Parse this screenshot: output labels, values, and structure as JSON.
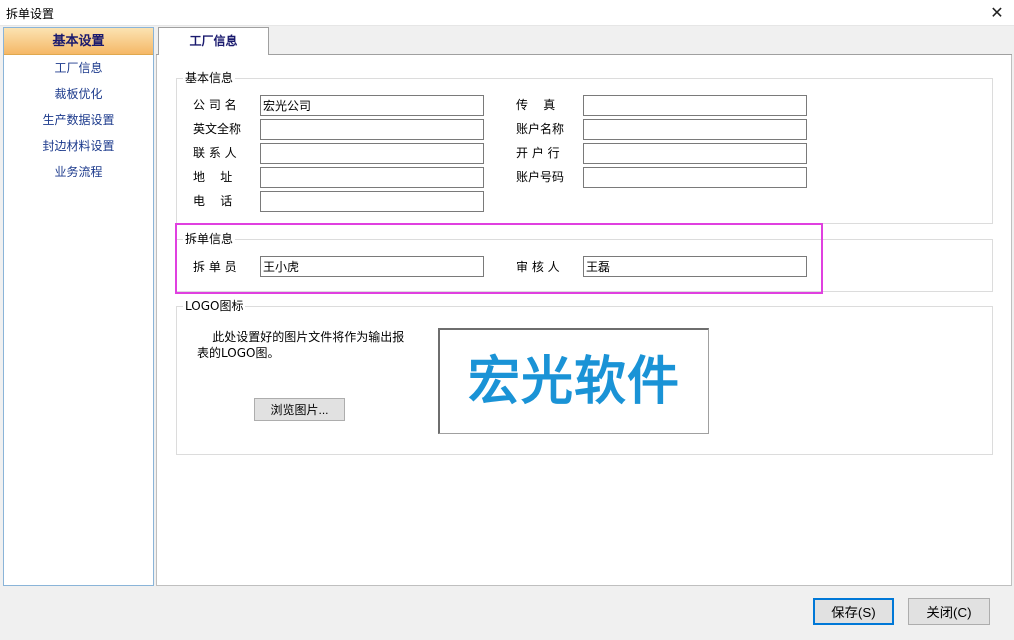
{
  "window": {
    "title": "拆单设置",
    "close_symbol": "✕"
  },
  "sidebar": {
    "header": "基本设置",
    "items": [
      {
        "label": "工厂信息"
      },
      {
        "label": "裁板优化"
      },
      {
        "label": "生产数据设置"
      },
      {
        "label": "封边材料设置"
      },
      {
        "label": "业务流程"
      }
    ]
  },
  "tabs": [
    {
      "label": "工厂信息"
    }
  ],
  "basic_info": {
    "legend": "基本信息",
    "left_fields": [
      {
        "label": "公 司 名",
        "value": ""
      },
      {
        "label": "英文全称",
        "value": ""
      },
      {
        "label": "联 系 人",
        "value": ""
      },
      {
        "label": "地    址",
        "value": ""
      },
      {
        "label": "电    话",
        "value": ""
      }
    ],
    "company_value": "宏光公司",
    "right_fields": [
      {
        "label": "传    真",
        "value": ""
      },
      {
        "label": "账户名称",
        "value": ""
      },
      {
        "label": "开 户 行",
        "value": ""
      },
      {
        "label": "账户号码",
        "value": ""
      }
    ]
  },
  "split_info": {
    "legend": "拆单信息",
    "splitter_label": "拆 单 员",
    "splitter_value": "王小虎",
    "reviewer_label": "审 核 人",
    "reviewer_value": "王磊"
  },
  "logo": {
    "legend": "LOGO图标",
    "description": "    此处设置好的图片文件将作为输出报表的LOGO图。",
    "browse_button": "浏览图片...",
    "image_text": "宏光软件",
    "image_color": "#1a93d6"
  },
  "footer": {
    "save_button": "保存(S)",
    "close_button": "关闭(C)"
  },
  "colors": {
    "highlight": "#e040e0",
    "sidebar_header": "#f5b867",
    "link_text": "#1c3a8c"
  }
}
